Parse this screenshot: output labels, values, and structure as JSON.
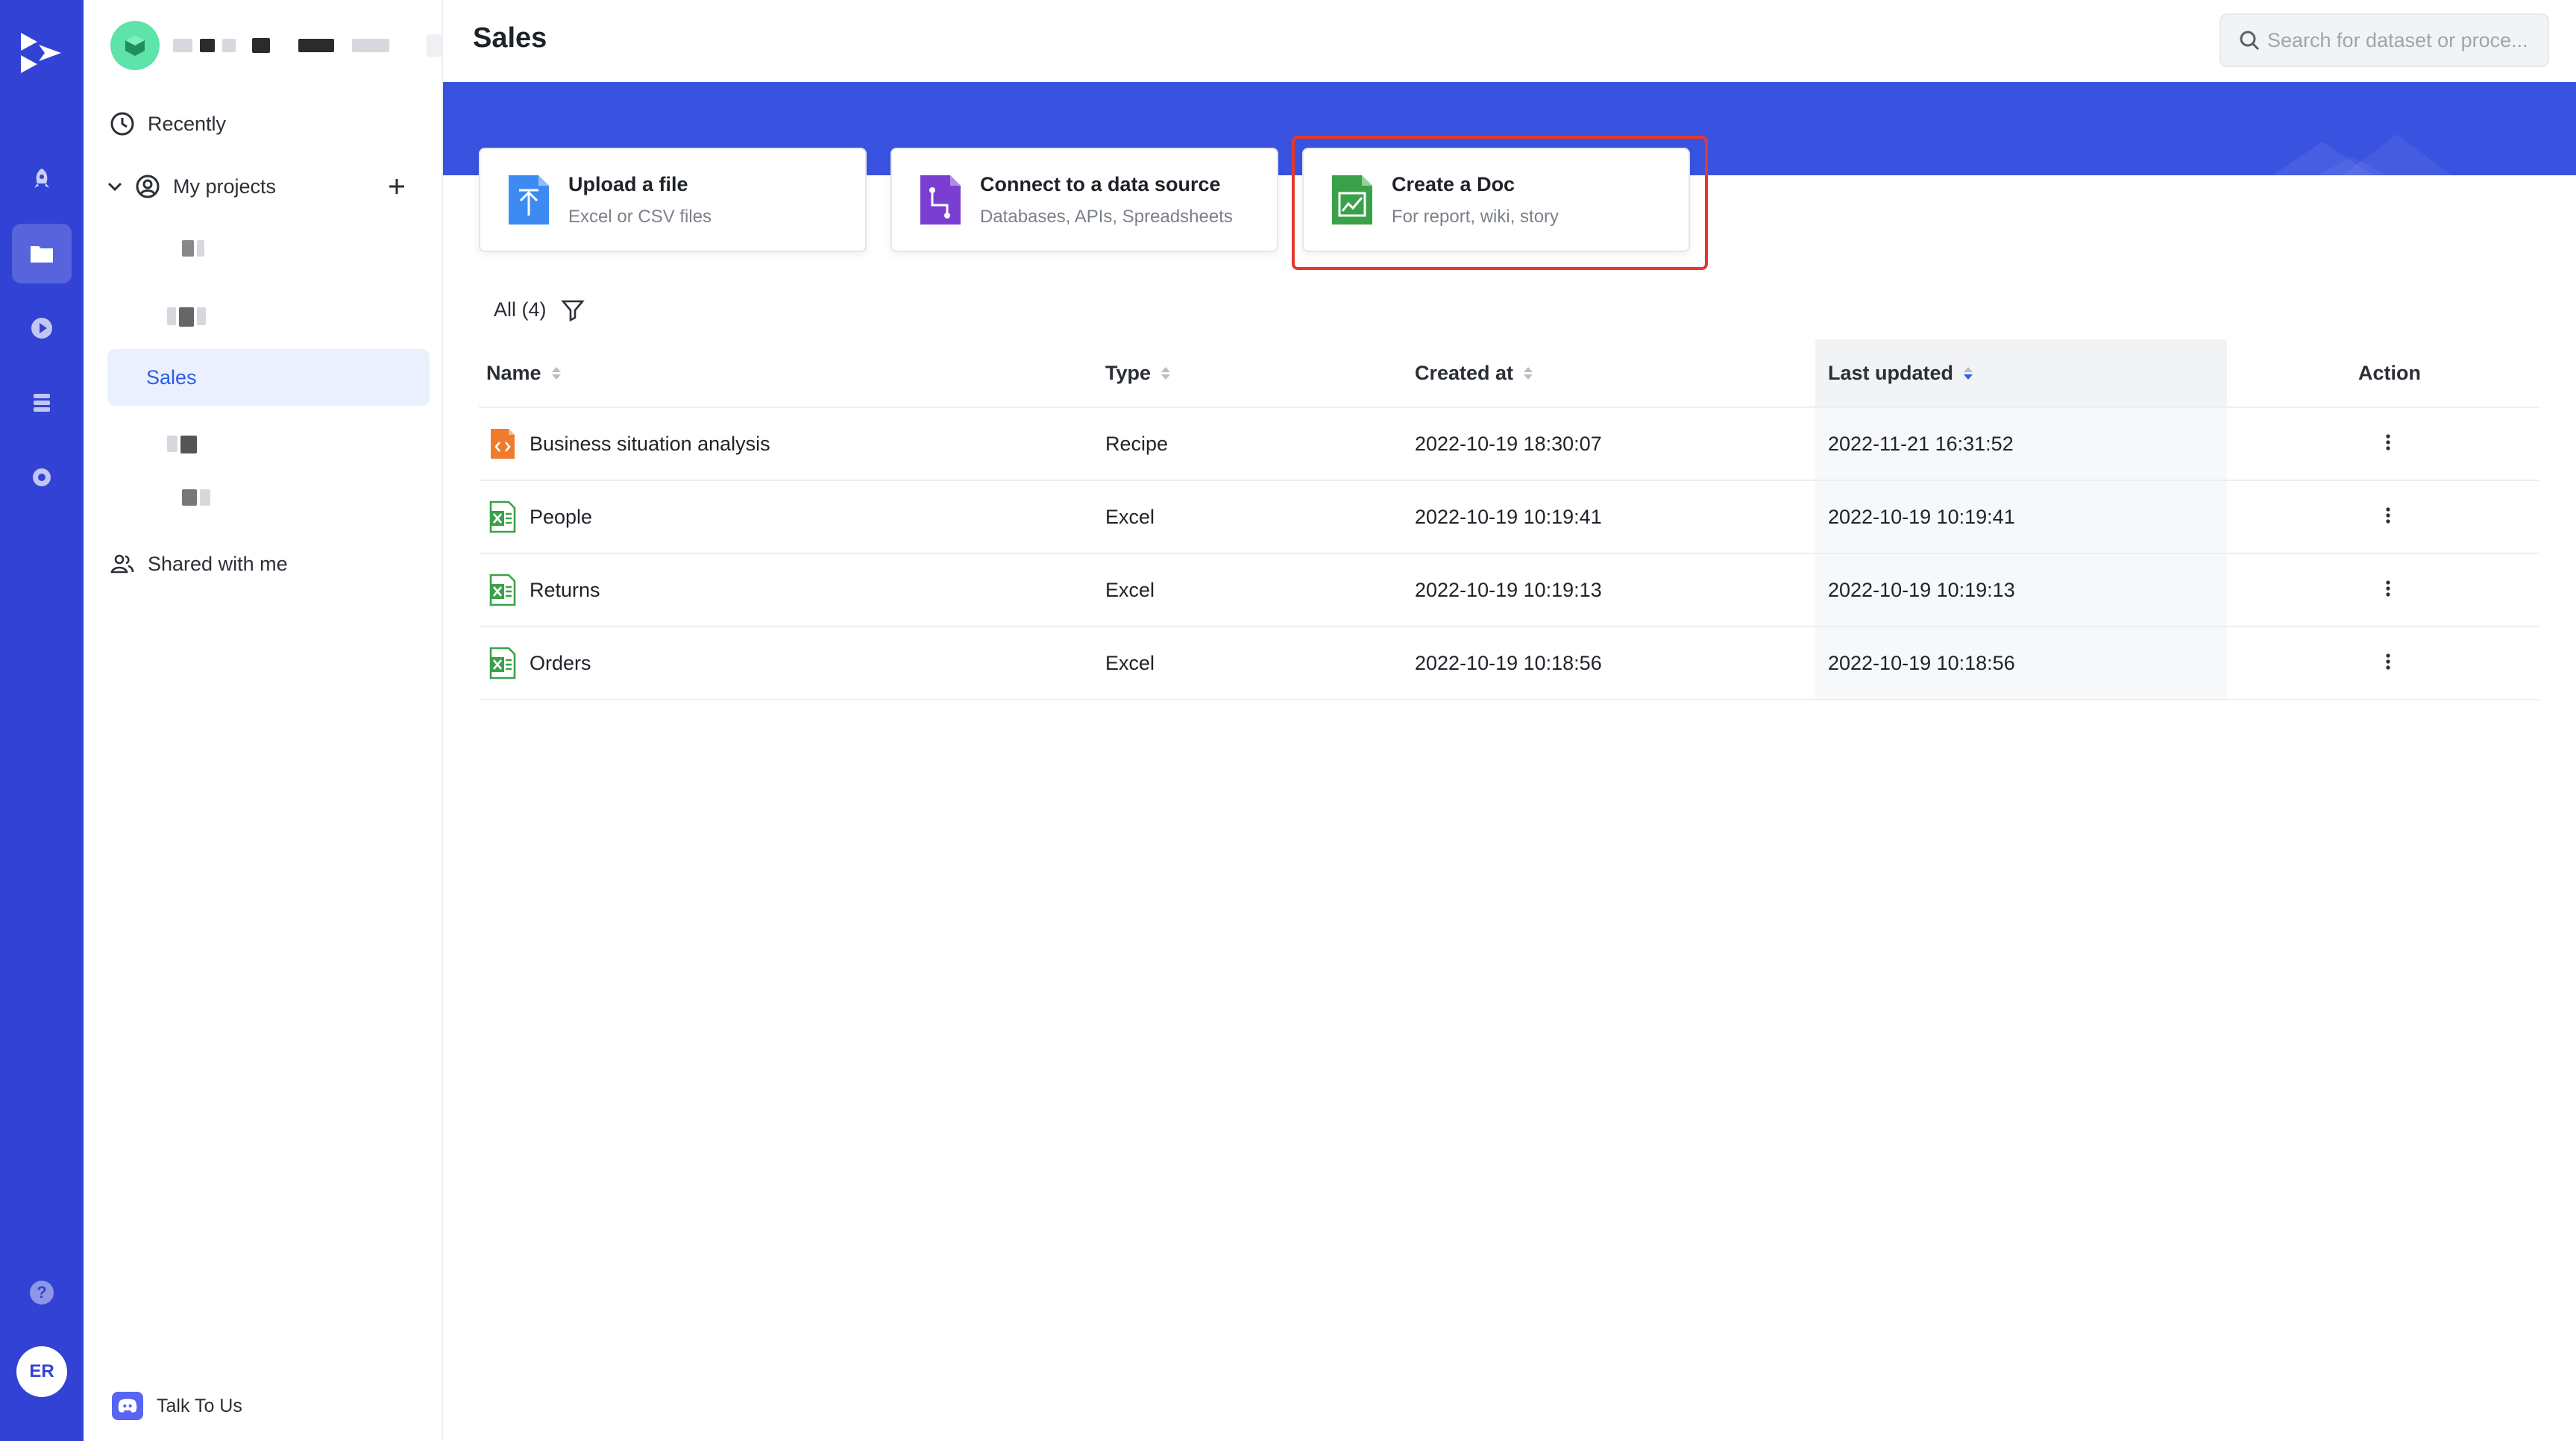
{
  "app": {
    "rail_avatar": "ER",
    "help_glyph": "?"
  },
  "sidebar": {
    "recently": "Recently",
    "my_projects": "My projects",
    "active_project": "Sales",
    "shared": "Shared with me",
    "talk": "Talk To Us"
  },
  "page": {
    "title": "Sales"
  },
  "search": {
    "placeholder": "Search for dataset or proce..."
  },
  "cards": [
    {
      "title": "Upload a file",
      "subtitle": "Excel or CSV files",
      "icon": "upload-icon",
      "color": "#3d8bf2"
    },
    {
      "title": "Connect to a data source",
      "subtitle": "Databases, APIs, Spreadsheets",
      "icon": "connect-icon",
      "color": "#7a3fd1"
    },
    {
      "title": "Create a Doc",
      "subtitle": "For report, wiki, story",
      "icon": "doc-icon",
      "color": "#3aa14a"
    }
  ],
  "filter": {
    "label": "All (4)"
  },
  "table": {
    "headers": [
      "Name",
      "Type",
      "Created at",
      "Last updated",
      "Action"
    ],
    "rows": [
      {
        "name": "Business situation analysis",
        "type": "Recipe",
        "created": "2022-10-19 18:30:07",
        "updated": "2022-11-21 16:31:52",
        "icon": "recipe-icon"
      },
      {
        "name": "People",
        "type": "Excel",
        "created": "2022-10-19 10:19:41",
        "updated": "2022-10-19 10:19:41",
        "icon": "excel-icon"
      },
      {
        "name": "Returns",
        "type": "Excel",
        "created": "2022-10-19 10:19:13",
        "updated": "2022-10-19 10:19:13",
        "icon": "excel-icon"
      },
      {
        "name": "Orders",
        "type": "Excel",
        "created": "2022-10-19 10:18:56",
        "updated": "2022-10-19 10:18:56",
        "icon": "excel-icon"
      }
    ]
  },
  "colors": {
    "rail": "#3242d4",
    "banner": "#3a52e0",
    "accent": "#2c5ce8",
    "highlight": "#e5382b"
  }
}
